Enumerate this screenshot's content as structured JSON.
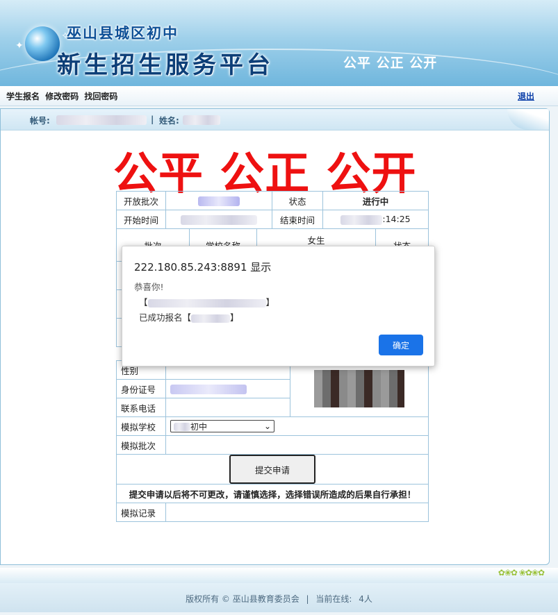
{
  "header": {
    "school_name": "巫山县城区初中",
    "platform_title": "新生招生服务平台",
    "slogan": "公平  公正  公开"
  },
  "nav": {
    "links": [
      "学生报名",
      "修改密码",
      "找回密码"
    ],
    "logout": "退出"
  },
  "account": {
    "account_label": "帐号:",
    "separator": "|",
    "name_label": "姓名:"
  },
  "main_slogan": "公平  公正  公开",
  "batch_table": {
    "open_batch_label": "开放批次",
    "status_label": "状态",
    "status_value": "进行中",
    "start_time_label": "开始时间",
    "end_time_label": "结束时间",
    "end_time_partial": ":14:25"
  },
  "quota_table": {
    "batch_header": "批次",
    "school_header": "学校名称",
    "girl_header": "女生",
    "status_header": "状态"
  },
  "student_table": {
    "gender_label": "性别",
    "id_label": "身份证号",
    "phone_label": "联系电话",
    "mock_school_label": "模拟学校",
    "mock_school_value": "初中",
    "mock_batch_label": "模拟批次",
    "submit_button": "提交申请",
    "warning": "提交申请以后将不可更改，请谨慎选择，选择错误所造成的后果自行承担！",
    "mock_record_label": "模拟记录"
  },
  "dialog": {
    "title": "222.180.85.243:8891 显示",
    "message": "恭喜你!",
    "line1_open": "【",
    "line1_close": "】",
    "line2_prefix": "已成功报名【",
    "line2_close": "】",
    "ok_button": "确定"
  },
  "footer": {
    "copyright": "版权所有 © 巫山县教育委员会",
    "separator": "|",
    "online_label": "当前在线:",
    "online_count": "4人"
  },
  "colors": {
    "accent_red": "#ee1111",
    "link_blue": "#0b3ea8",
    "ok_blue": "#1a73e8"
  }
}
